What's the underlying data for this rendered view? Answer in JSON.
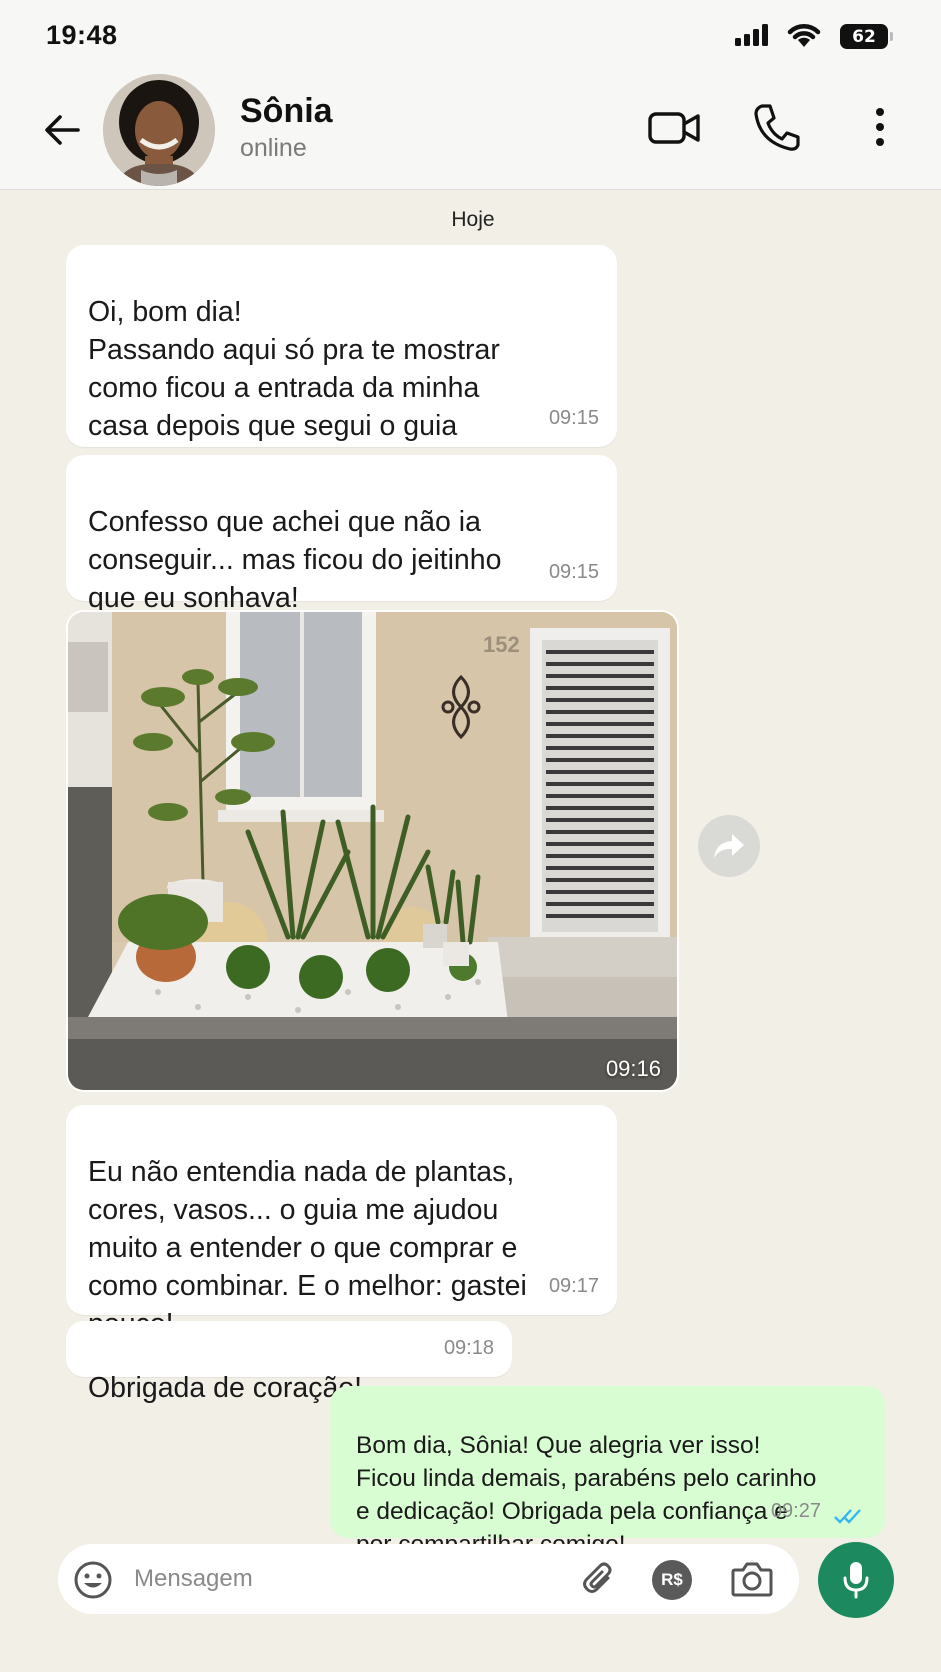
{
  "status_bar": {
    "time": "19:48",
    "battery": "62"
  },
  "header": {
    "contact_name": "Sônia",
    "contact_status": "online"
  },
  "chat": {
    "date_label": "Hoje",
    "messages": [
      {
        "text": "Oi, bom dia!\nPassando aqui só pra te mostrar\ncomo ficou a entrada da minha\ncasa depois que segui o guia",
        "time": "09:15",
        "direction": "incoming"
      },
      {
        "text": "Confesso que achei que não ia\nconseguir... mas ficou do jeitinho\nque eu sonhava!",
        "time": "09:15",
        "direction": "incoming"
      },
      {
        "image": {
          "house_number": "152"
        },
        "time": "09:16",
        "direction": "incoming"
      },
      {
        "text": "Eu não entendia nada de plantas,\ncores, vasos... o guia me ajudou\nmuito a entender o que comprar e\ncomo combinar. E o melhor: gastei\npouco!",
        "time": "09:17",
        "direction": "incoming"
      },
      {
        "text": "Obrigada de coração!",
        "time": "09:18",
        "direction": "incoming"
      },
      {
        "text": "Bom dia, Sônia! Que alegria ver isso!\nFicou linda demais, parabéns pelo carinho\ne dedicação! Obrigada pela confiança e\npor compartilhar comigo!",
        "time": "09:27",
        "direction": "outgoing",
        "status": "read"
      }
    ]
  },
  "input": {
    "placeholder": "Mensagem",
    "value": "",
    "pay_label": "R$"
  },
  "colors": {
    "accent": "#1c8a5e",
    "outgoing_bubble": "#d9fdd3",
    "incoming_bubble": "#ffffff",
    "read_ticks": "#34b7f1",
    "background": "#f2efe7"
  },
  "icons": [
    "back-arrow-icon",
    "video-call-icon",
    "phone-icon",
    "more-vertical-icon",
    "forward-icon",
    "double-check-icon",
    "emoji-icon",
    "paperclip-icon",
    "camera-icon",
    "microphone-icon"
  ]
}
